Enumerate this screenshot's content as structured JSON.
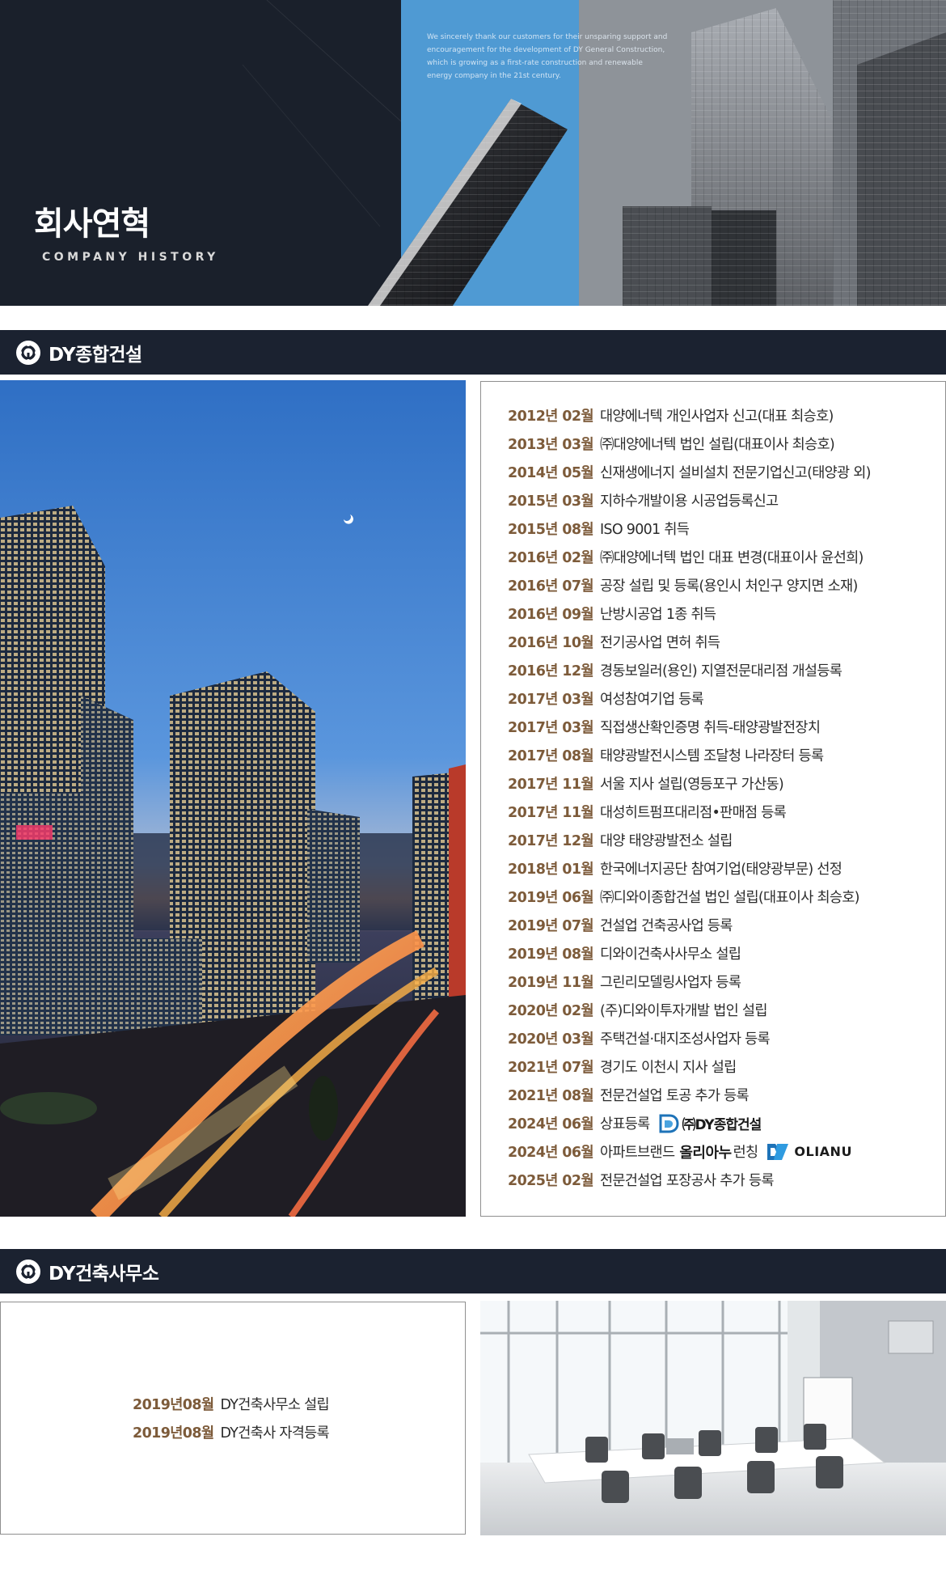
{
  "hero": {
    "title": "회사연혁",
    "subtitle": "COMPANY HISTORY",
    "quote": "We sincerely thank our customers for their unsparing support and encouragement for the development of DY General Construction, which is growing as a first-rate construction and renewable energy company in the 21st century."
  },
  "sections": {
    "construction": {
      "title": "DY종합건설"
    },
    "architecture": {
      "title": "DY건축사무소"
    }
  },
  "history": [
    {
      "date": "2012년 02월",
      "text": "대양에너텍 개인사업자 신고(대표 최승호)"
    },
    {
      "date": "2013년 03월",
      "text": "㈜대양에너텍 법인 설립(대표이사 최승호)"
    },
    {
      "date": "2014년 05월",
      "text": "신재생에너지 설비설치 전문기업신고(태양광 외)"
    },
    {
      "date": "2015년 03월",
      "text": "지하수개발이용 시공업등록신고"
    },
    {
      "date": "2015년 08월",
      "text": "ISO 9001 취득"
    },
    {
      "date": "2016년 02월",
      "text": "㈜대양에너텍 법인 대표 변경(대표이사 윤선희)"
    },
    {
      "date": "2016년 07월",
      "text": "공장 설립 및 등록(용인시 처인구 양지면 소재)"
    },
    {
      "date": "2016년 09월",
      "text": "난방시공업 1종 취득"
    },
    {
      "date": "2016년 10월",
      "text": "전기공사업 면허 취득"
    },
    {
      "date": "2016년 12월",
      "text": "경동보일러(용인) 지열전문대리점 개설등록"
    },
    {
      "date": "2017년 03월",
      "text": "여성참여기업 등록"
    },
    {
      "date": "2017년 03월",
      "text": "직접생산확인증명 취득-태양광발전장치"
    },
    {
      "date": "2017년 08월",
      "text": "태양광발전시스템 조달청 나라장터 등록"
    },
    {
      "date": "2017년 11월",
      "text": "서울 지사 설립(영등포구 가산동)"
    },
    {
      "date": "2017년 11월",
      "text": "대성히트펌프대리점•판매점 등록"
    },
    {
      "date": "2017년 12월",
      "text": "대양 태양광발전소 설립"
    },
    {
      "date": "2018년 01월",
      "text": "한국에너지공단 참여기업(태양광부문) 선정"
    },
    {
      "date": "2019년 06월",
      "text": "㈜디와이종합건설 법인 설립(대표이사 최승호)"
    },
    {
      "date": "2019년 07월",
      "text": "건설업 건축공사업 등록"
    },
    {
      "date": "2019년 08월",
      "text": "디와이건축사사무소 설립"
    },
    {
      "date": "2019년 11월",
      "text": "그린리모델링사업자 등록"
    },
    {
      "date": "2020년 02월",
      "text": "(주)디와이투자개발 법인 설립"
    },
    {
      "date": "2020년 03월",
      "text": "주택건설·대지조성사업자 등록"
    },
    {
      "date": "2021년 07월",
      "text": "경기도 이천시 지사 설립"
    },
    {
      "date": "2021년 08월",
      "text": "전문건설업 토공 추가 등록"
    }
  ],
  "trademark": {
    "date": "2024년 06월",
    "text": "상표등록",
    "logo_text": "㈜DY종합건설",
    "logo_icon": "dy-logo-icon"
  },
  "brand": {
    "date": "2024년 06월",
    "text": "아파트브랜드",
    "brand_kr": "올리아누",
    "suffix": "런칭",
    "brand_en": "OLIANU",
    "logo_icon": "olianu-logo-icon"
  },
  "last": {
    "date": "2025년 02월",
    "text": "전문건설업 포장공사 추가 등록"
  },
  "architecture_history": [
    {
      "date": "2019년08월",
      "text": "DY건축사무소 설립"
    },
    {
      "date": "2019년08월",
      "text": "DY건축사 자격등록"
    }
  ],
  "colors": {
    "dark_navy": "#1b2230",
    "date_brown": "#7d5b3a",
    "hero_blue": "#4f9ad3",
    "brand_blue": "#1e73b8"
  }
}
